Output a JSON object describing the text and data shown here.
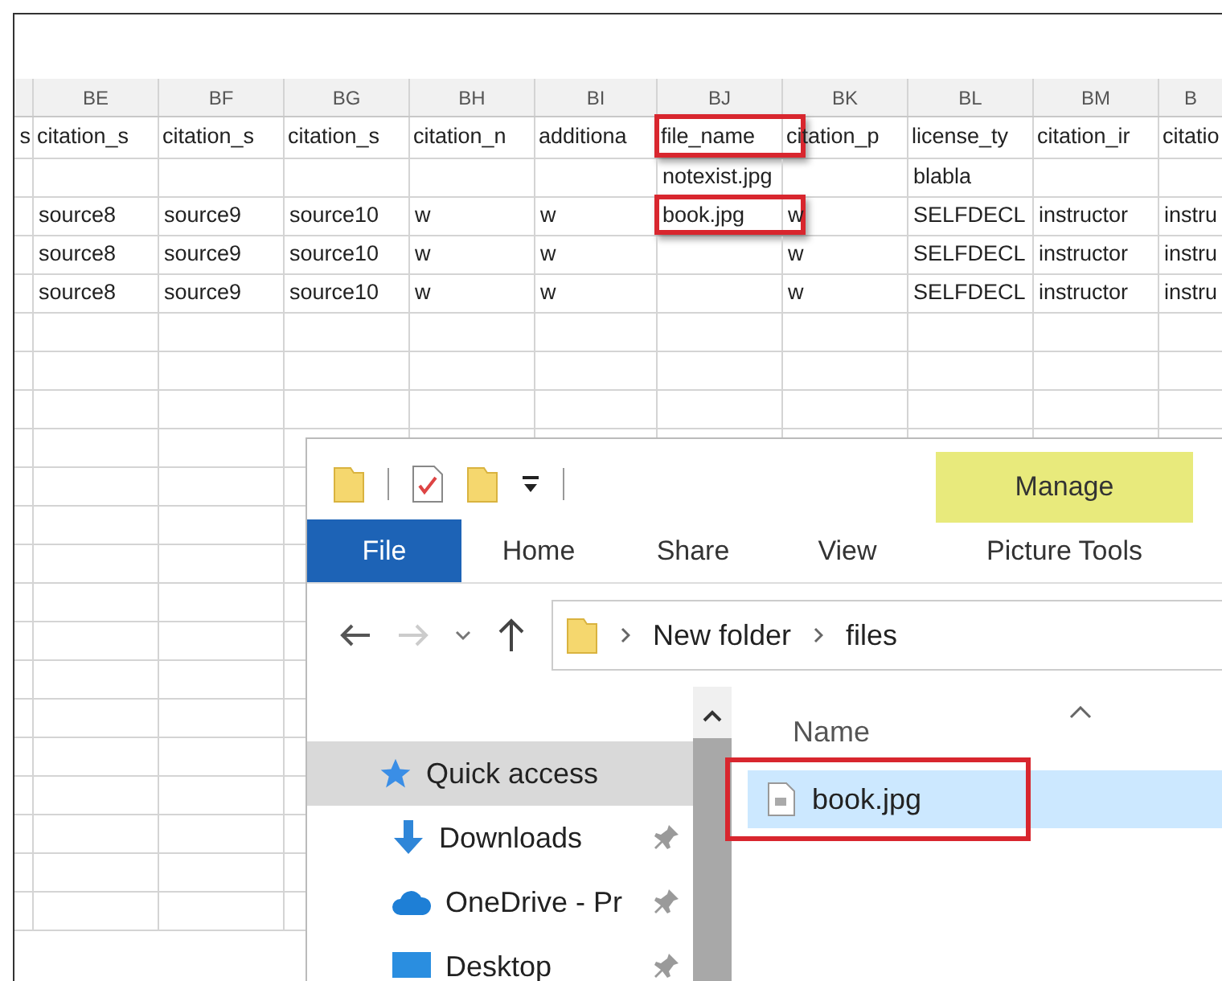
{
  "spreadsheet": {
    "columns": [
      {
        "field": "s",
        "highlighted": false
      },
      {
        "letter": "BE",
        "field": "citation_s",
        "highlighted": false
      },
      {
        "letter": "BF",
        "field": "citation_s",
        "highlighted": false
      },
      {
        "letter": "BG",
        "field": "citation_s",
        "highlighted": false
      },
      {
        "letter": "BH",
        "field": "citation_n",
        "highlighted": false
      },
      {
        "letter": "BI",
        "field": "additiona",
        "highlighted": false
      },
      {
        "letter": "BJ",
        "field": "file_name",
        "highlighted": true
      },
      {
        "letter": "BK",
        "field": "citation_p",
        "highlighted": false
      },
      {
        "letter": "BL",
        "field": "license_ty",
        "highlighted": false
      },
      {
        "letter": "BM",
        "field": "citation_ir",
        "highlighted": false
      },
      {
        "letter": "B",
        "field": "citatio",
        "highlighted": false
      }
    ],
    "rows": [
      [
        null,
        null,
        null,
        null,
        null,
        null,
        {
          "text": "notexist.jpg",
          "highlighted": false
        },
        null,
        {
          "text": "blabla",
          "highlighted": false
        },
        null,
        null
      ],
      [
        null,
        {
          "text": "source8",
          "highlighted": false
        },
        {
          "text": "source9",
          "highlighted": false
        },
        {
          "text": "source10",
          "highlighted": false
        },
        {
          "text": "w",
          "highlighted": false
        },
        {
          "text": "w",
          "highlighted": false
        },
        {
          "text": "book.jpg",
          "highlighted": true
        },
        {
          "text": "w",
          "highlighted": false
        },
        {
          "text": "SELFDECL",
          "highlighted": false
        },
        {
          "text": "instructor",
          "highlighted": false
        },
        {
          "text": "instru",
          "highlighted": false
        }
      ],
      [
        null,
        {
          "text": "source8",
          "highlighted": false
        },
        {
          "text": "source9",
          "highlighted": false
        },
        {
          "text": "source10",
          "highlighted": false
        },
        {
          "text": "w",
          "highlighted": false
        },
        {
          "text": "w",
          "highlighted": false
        },
        null,
        {
          "text": "w",
          "highlighted": false
        },
        {
          "text": "SELFDECL",
          "highlighted": false
        },
        {
          "text": "instructor",
          "highlighted": false
        },
        {
          "text": "instru",
          "highlighted": false
        }
      ],
      [
        null,
        {
          "text": "source8",
          "highlighted": false
        },
        {
          "text": "source9",
          "highlighted": false
        },
        {
          "text": "source10",
          "highlighted": false
        },
        {
          "text": "w",
          "highlighted": false
        },
        {
          "text": "w",
          "highlighted": false
        },
        null,
        {
          "text": "w",
          "highlighted": false
        },
        {
          "text": "SELFDECL",
          "highlighted": false
        },
        {
          "text": "instructor",
          "highlighted": false
        },
        {
          "text": "instru",
          "highlighted": false
        }
      ]
    ]
  },
  "explorer": {
    "ribbon_tabs": [
      {
        "label": "File",
        "kind": "file"
      },
      {
        "label": "Home",
        "kind": "tab"
      },
      {
        "label": "Share",
        "kind": "tab"
      },
      {
        "label": "View",
        "kind": "tab"
      }
    ],
    "context_tab": {
      "group": "Manage",
      "label": "Picture Tools"
    },
    "breadcrumb": [
      "New folder",
      "files"
    ],
    "nav_items": [
      {
        "label": "Quick access",
        "kind": "star",
        "selected": true,
        "pinned": false
      },
      {
        "label": "Downloads",
        "kind": "download",
        "selected": false,
        "pinned": true
      },
      {
        "label": "OneDrive - Pr",
        "kind": "cloud",
        "selected": false,
        "pinned": true
      },
      {
        "label": "Desktop",
        "kind": "desktop",
        "selected": false,
        "pinned": true
      }
    ],
    "column_header": "Name",
    "files": [
      {
        "name": "book.jpg",
        "selected": true,
        "highlighted": true
      }
    ]
  }
}
